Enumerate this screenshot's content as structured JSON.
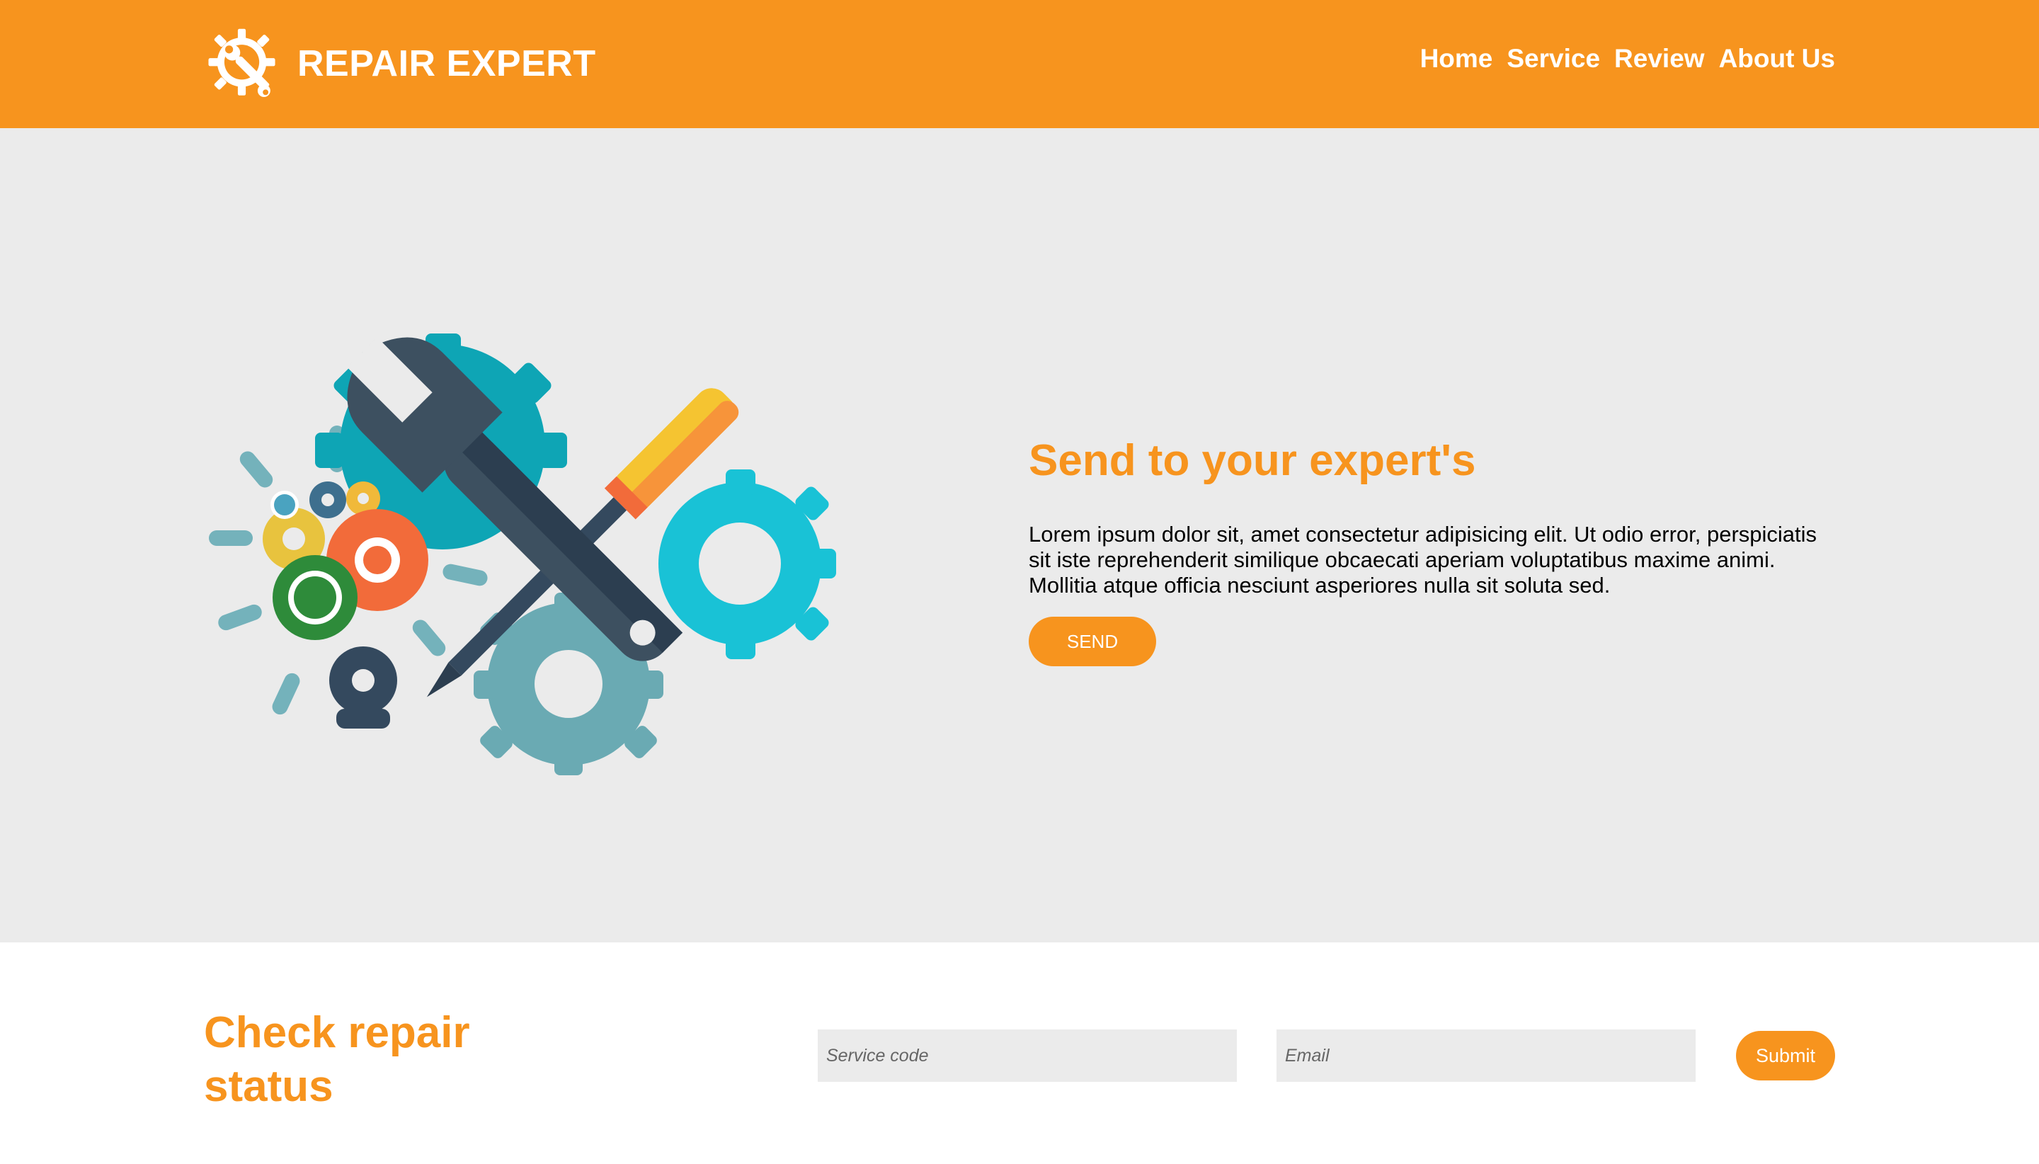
{
  "header": {
    "logo_text": "REPAIR EXPERT",
    "logo_icon": "gear-wrench-icon",
    "nav": [
      {
        "label": "Home"
      },
      {
        "label": "Service"
      },
      {
        "label": "Review"
      },
      {
        "label": "About Us"
      }
    ]
  },
  "hero": {
    "illustration": "gears-wrench-screwdriver-illustration",
    "title": "Send to your expert's",
    "text": "Lorem ipsum dolor sit, amet consectetur adipisicing elit. Ut odio error, perspiciatis sit iste reprehenderit similique obcaecati aperiam voluptatibus maxime animi. Mollitia atque officia nesciunt asperiores nulla sit soluta sed.",
    "button_label": "SEND"
  },
  "status": {
    "title": "Check repair status",
    "service_placeholder": "Service code",
    "email_placeholder": "Email",
    "submit_label": "Submit"
  },
  "colors": {
    "accent": "#f7941e",
    "hero_bg": "#ebebeb",
    "input_bg": "#ebebeb"
  }
}
